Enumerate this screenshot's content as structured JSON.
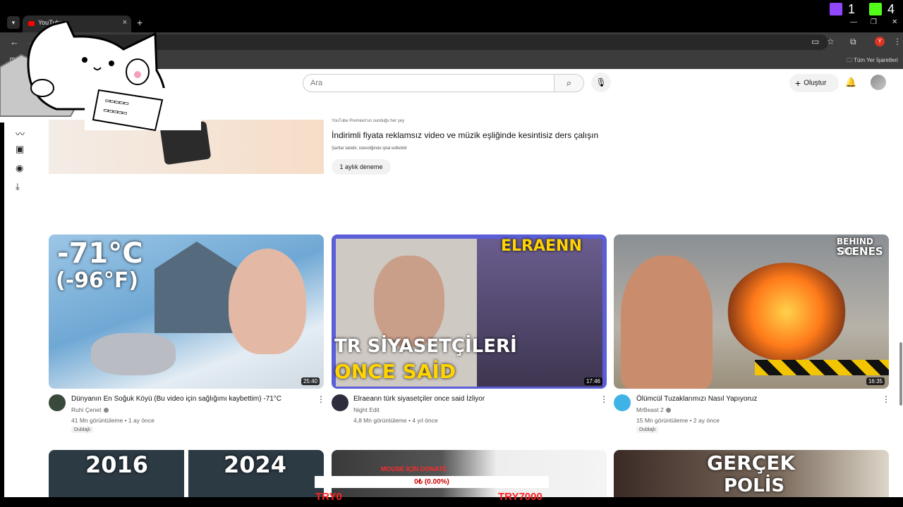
{
  "browser": {
    "tab_title": "YouTube",
    "tab_close": "×",
    "new_tab": "+",
    "bookmarks_all": "Tüm Yer İşaretleri",
    "profile_letter": "Y"
  },
  "stream_overlay": {
    "twitch_count": "1",
    "kick_count": "4",
    "donate_label": "MOUSE İÇİN DONATE",
    "donate_progress": "0₺ (0.00%)",
    "donate_fraction": 0,
    "donate_min": "TRY0",
    "donate_max": "TRY7000"
  },
  "header": {
    "search_placeholder": "Ara",
    "create_label": "Oluştur"
  },
  "promo": {
    "tiny_text": "YouTube Premium'un sunduğu her şey",
    "title": "İndirimli fiyata reklamsız video ve müzik eşliğinde kesintisiz ders çalışın",
    "subtitle": "Şartlar tabidir, istendiğinde iptal edilebilir",
    "button": "1 aylık deneme"
  },
  "videos": [
    {
      "thumb_text_1": "-71°C",
      "thumb_text_2": "(-96°F)",
      "duration": "25:40",
      "title": "Dünyanın En Soğuk Köyü (Bu video için sağlığımı kaybettim) -71°C",
      "channel": "Ruhi Çenet",
      "meta": "41 Mn görüntüleme • 1 ay önce",
      "badge": "Dublajlı"
    },
    {
      "thumb_text_1": "TR SİYASETÇİLERİ",
      "thumb_text_2": "ONCE SAİD",
      "thumb_text_3": "ELRAENN",
      "duration": "17:46",
      "title": "Elraeann türk siyasetçiler once said İzliyor",
      "channel": "Night Edit",
      "meta": "4,8 Mn görüntüleme • 4 yıl önce",
      "badge": ""
    },
    {
      "thumb_text_1": "BEHIND THE",
      "thumb_text_2": "SCENES",
      "duration": "16:35",
      "title": "Ölümcül Tuzaklarımızı Nasıl Yapıyoruz",
      "channel": "MrBeast 2",
      "meta": "15 Mn görüntüleme • 2 ay önce",
      "badge": "Dublajlı"
    }
  ],
  "row2": {
    "t1a": "2016",
    "t1b": "2024",
    "t3a": "GERÇEK",
    "t3b": "POLİS"
  },
  "icons": {
    "more": "⋮"
  }
}
